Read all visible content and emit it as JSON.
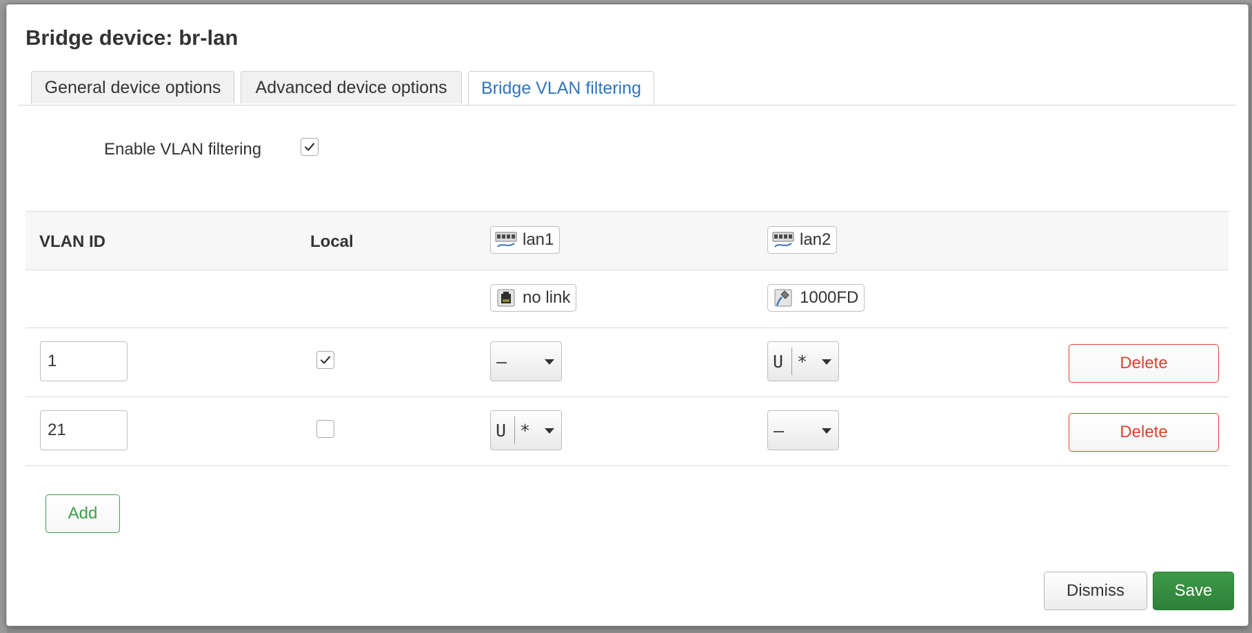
{
  "dialog": {
    "title": "Bridge device: br-lan"
  },
  "tabs": [
    {
      "label": "General device options",
      "active": false
    },
    {
      "label": "Advanced device options",
      "active": false
    },
    {
      "label": "Bridge VLAN filtering",
      "active": true
    }
  ],
  "vlan_filtering": {
    "label": "Enable VLAN filtering",
    "checked": true
  },
  "table": {
    "columns": {
      "vlan_id": "VLAN ID",
      "local": "Local",
      "ports": [
        {
          "name": "lan1",
          "icon": "ethernet-port-icon",
          "status": "no link",
          "status_icon": "port-no-link-icon"
        },
        {
          "name": "lan2",
          "icon": "ethernet-port-icon",
          "status": "1000FD",
          "status_icon": "port-connected-icon"
        }
      ]
    },
    "rows": [
      {
        "vlan_id": "1",
        "local": true,
        "lan1": {
          "tag": "–",
          "pvid": ""
        },
        "lan2": {
          "tag": "U",
          "pvid": "*"
        },
        "delete_label": "Delete"
      },
      {
        "vlan_id": "21",
        "local": false,
        "lan1": {
          "tag": "U",
          "pvid": "*"
        },
        "lan2": {
          "tag": "–",
          "pvid": ""
        },
        "delete_label": "Delete"
      }
    ],
    "add_label": "Add"
  },
  "footer": {
    "dismiss_label": "Dismiss",
    "save_label": "Save"
  },
  "colors": {
    "accent": "#2f74c0",
    "danger": "#d9442e",
    "positive": "#3b9e4a",
    "save_bg": "#348c3f"
  }
}
